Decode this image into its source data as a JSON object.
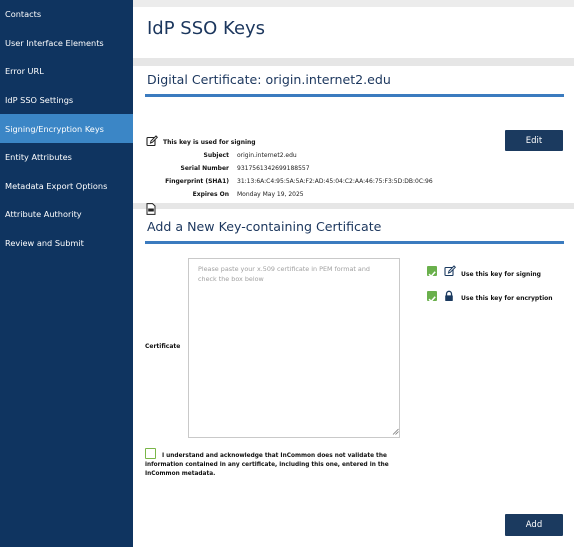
{
  "sidebar": {
    "items": [
      {
        "label": "Contacts",
        "active": false
      },
      {
        "label": "User Interface Elements",
        "active": false
      },
      {
        "label": "Error URL",
        "active": false
      },
      {
        "label": "IdP SSO Settings",
        "active": false
      },
      {
        "label": "Signing/Encryption Keys",
        "active": true
      },
      {
        "label": "Entity Attributes",
        "active": false
      },
      {
        "label": "Metadata Export Options",
        "active": false
      },
      {
        "label": "Attribute Authority",
        "active": false
      },
      {
        "label": "Review and Submit",
        "active": false
      }
    ]
  },
  "page_title": "IdP SSO Keys",
  "certificate": {
    "title": "Digital Certificate: origin.internet2.edu",
    "usage": "This key is used for signing",
    "fields": [
      {
        "label": "Subject",
        "value": "origin.internet2.edu"
      },
      {
        "label": "Serial Number",
        "value": "9317561342699188557"
      },
      {
        "label": "Fingerprint (SHA1)",
        "value": "31:13:6A:C4:95:5A:5A:F2:AD:45:04:C2:AA:46:75:F3:5D:DB:0C:96"
      },
      {
        "label": "Expires On",
        "value": "Monday May 19, 2025"
      }
    ],
    "edit_label": "Edit"
  },
  "new_key": {
    "title": "Add a New Key-containing Certificate",
    "certificate_label": "Certificate",
    "placeholder": "Please paste your x.509 certificate in PEM format and check the box below",
    "use_signing_label": "Use this key for signing",
    "use_signing_checked": true,
    "use_encryption_label": "Use this key for encryption",
    "use_encryption_checked": true,
    "acknowledge_label": "I understand and acknowledge that InCommon does not validate the information contained in any certificate, including this one, entered in the InCommon metadata.",
    "acknowledge_checked": false,
    "add_label": "Add"
  },
  "colors": {
    "sidebar_bg": "#0f3460",
    "sidebar_active": "#3b86c6",
    "accent_rule": "#3b7bbf",
    "button_bg": "#1b3a5f",
    "checkbox_green": "#6ab04c",
    "heading": "#1b365d"
  },
  "icons": {
    "usage_icon": "pencil-square-icon",
    "file_icon": "document-icon",
    "encryption_icon": "lock-icon",
    "resize_icon": "resize-grip-icon"
  }
}
